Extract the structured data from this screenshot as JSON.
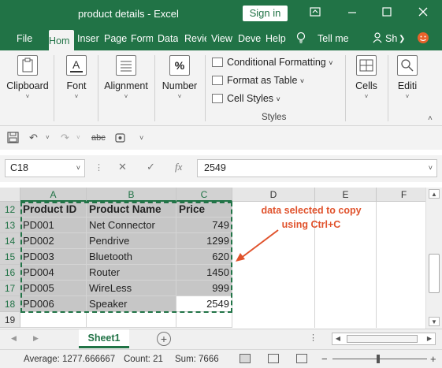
{
  "window": {
    "title": "product details  -  Excel",
    "signin_label": "Sign in"
  },
  "tabs": [
    "File",
    "Hom",
    "Inser",
    "Page",
    "Form",
    "Data",
    "Revie",
    "View",
    "Deve",
    "Help"
  ],
  "tell_me": "Tell me",
  "share_label": "Sh",
  "ribbon": {
    "clipboard": "Clipboard",
    "font": "Font",
    "alignment": "Alignment",
    "number": "Number",
    "number_icon": "%",
    "conditional_formatting": "Conditional Formatting",
    "format_as_table": "Format as Table",
    "cell_styles": "Cell Styles",
    "styles_group": "Styles",
    "cells": "Cells",
    "editing": "Editi"
  },
  "qat": {
    "abc_label": "abc"
  },
  "formula_bar": {
    "name_box": "C18",
    "fx_label": "fx",
    "formula_value": "2549"
  },
  "grid": {
    "columns": [
      "A",
      "B",
      "C",
      "D",
      "E",
      "F"
    ],
    "row_numbers": [
      "12",
      "13",
      "14",
      "15",
      "16",
      "17",
      "18",
      "19"
    ],
    "headers": [
      "Product  ID",
      "Product Name",
      "Price"
    ],
    "rows": [
      [
        "PD001",
        "Net Connector",
        "749"
      ],
      [
        "PD002",
        "Pendrive",
        "1299"
      ],
      [
        "PD003",
        "Bluetooth",
        "620"
      ],
      [
        "PD004",
        "Router",
        "1450"
      ],
      [
        "PD005",
        "WireLess",
        "999"
      ],
      [
        "PD006",
        "Speaker",
        "2549"
      ]
    ]
  },
  "annotation": {
    "line1": "data selected to copy",
    "line2": "using Ctrl+C"
  },
  "sheet_tab": "Sheet1",
  "add_sheet": "+",
  "status": {
    "average": "Average: 1277.666667",
    "count": "Count: 21",
    "sum": "Sum: 7666",
    "zoom_minus": "−",
    "zoom_plus": "+"
  },
  "colors": {
    "excel_green": "#217346",
    "annotation_red": "#e0522c",
    "selection_gray": "#c6c6c6"
  }
}
